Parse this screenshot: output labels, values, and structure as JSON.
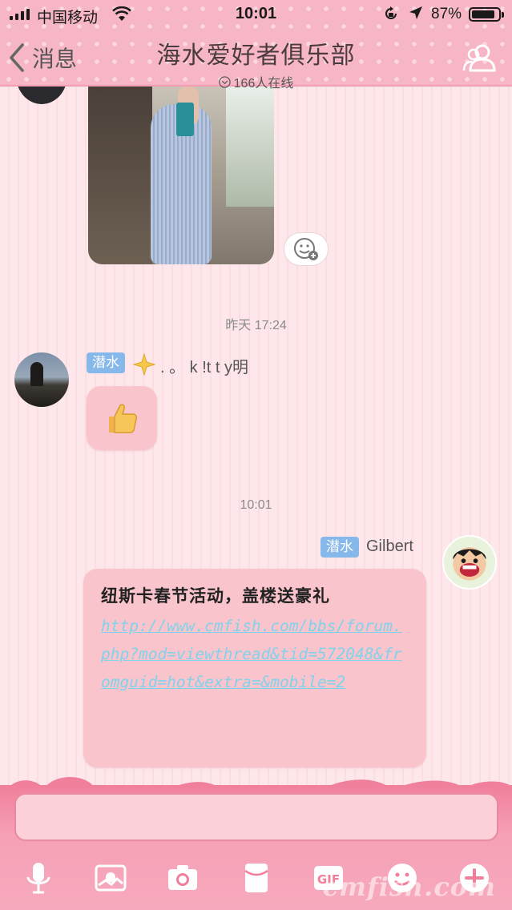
{
  "status_bar": {
    "carrier": "中国移动",
    "time": "10:01",
    "battery_pct": "87%",
    "battery_level": 0.87
  },
  "nav": {
    "back_label": "消息",
    "title": "海水爱好者俱乐部",
    "online": "166人在线"
  },
  "chat": {
    "timestamps": [
      "昨天 17:24",
      "10:01"
    ],
    "msg_left": {
      "badge": "潜水",
      "sender": ". 。 k !t t y明"
    },
    "msg_right": {
      "badge": "潜水",
      "sender": "Gilbert",
      "headline": "纽斯卡春节活动，盖楼送豪礼",
      "link": "http://www.cmfish.com/bbs/forum.php?mod=viewthread&tid=572048&fromguid=hot&extra=&mobile=2"
    }
  },
  "watermark": "cmfish.com",
  "colors": {
    "topbar": "#f7b6c5",
    "bubble": "#f9c4cb",
    "badge": "#86b8ea",
    "link": "#7fd3ec",
    "toolbar": "#f07f9b"
  },
  "toolbar_icons": [
    "microphone-icon",
    "photo-album-icon",
    "camera-icon",
    "red-packet-icon",
    "gif-icon",
    "emoji-icon",
    "plus-icon"
  ]
}
